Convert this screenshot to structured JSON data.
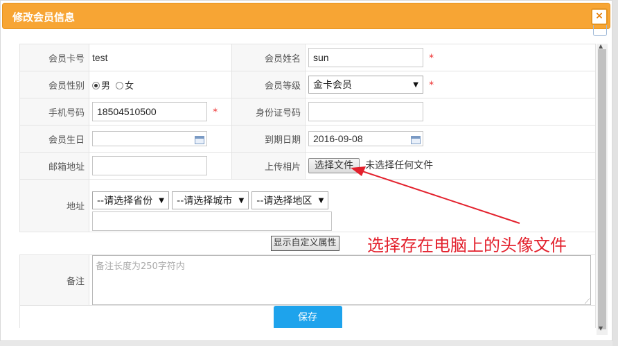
{
  "dialog": {
    "title": "修改会员信息",
    "close_icon": "close-icon"
  },
  "form": {
    "card_no": {
      "label": "会员卡号",
      "value": "test"
    },
    "name": {
      "label": "会员姓名",
      "value": "sun",
      "required": "*"
    },
    "gender": {
      "label": "会员性别",
      "options": [
        "男",
        "女"
      ],
      "selected": "男"
    },
    "level": {
      "label": "会员等级",
      "value": "金卡会员",
      "required": "*"
    },
    "phone": {
      "label": "手机号码",
      "value": "18504510500",
      "required": "*"
    },
    "id_no": {
      "label": "身份证号码",
      "value": ""
    },
    "birthday": {
      "label": "会员生日",
      "value": ""
    },
    "expiry": {
      "label": "到期日期",
      "value": "2016-09-08"
    },
    "email": {
      "label": "邮箱地址",
      "value": ""
    },
    "photo": {
      "label": "上传相片",
      "button": "选择文件",
      "status": "未选择任何文件"
    },
    "address": {
      "label": "地址",
      "province": "--请选择省份",
      "city": "--请选择城市",
      "district": "--请选择地区",
      "detail": ""
    },
    "custom_attr_button": "显示自定义属性",
    "remark": {
      "label": "备注",
      "placeholder": "备注长度为250字符内"
    },
    "save_button": "保存"
  },
  "annotation": {
    "text": "选择存在电脑上的头像文件",
    "color": "#e3212d"
  },
  "colors": {
    "titlebar": "#f7a534",
    "save_button": "#1ea3ec",
    "required": "#ee3333"
  }
}
